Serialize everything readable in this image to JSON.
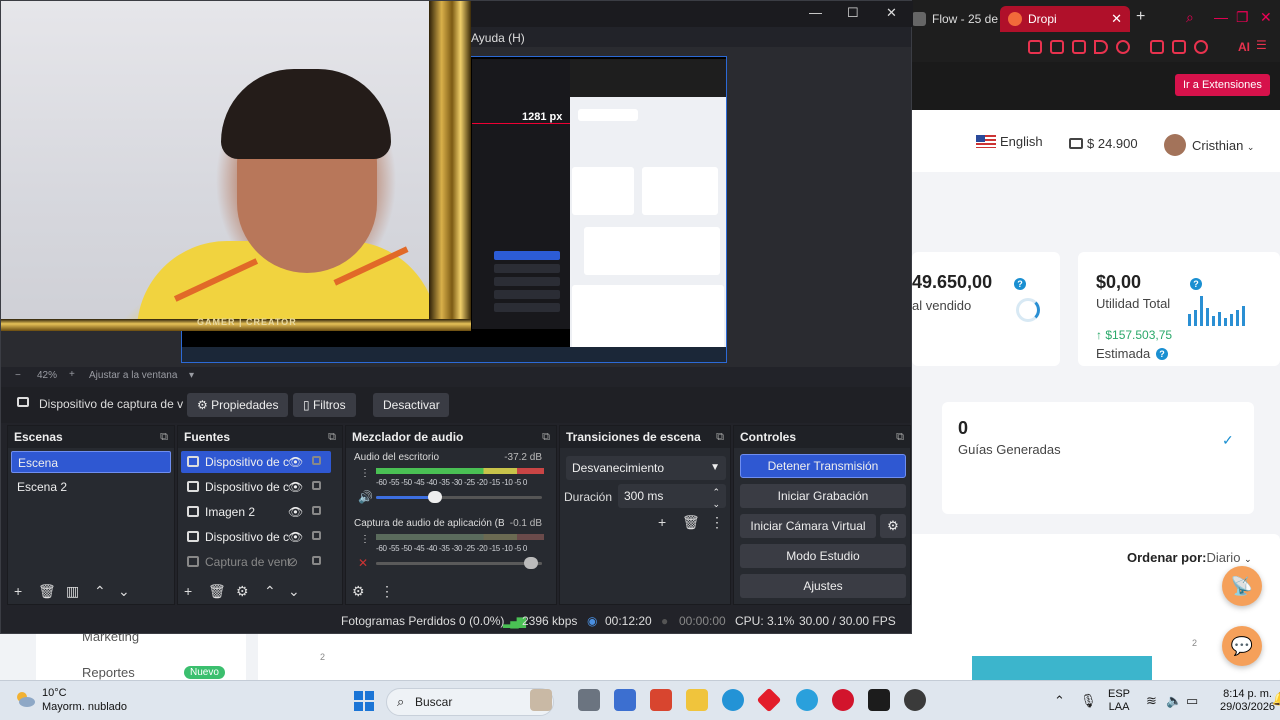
{
  "browser": {
    "tabs": [
      {
        "label": "Flow - 25 de"
      },
      {
        "label": "Dropi"
      }
    ],
    "new_tab": "+",
    "ai_label": "AI",
    "extensions_button": "Ir a Extensiones",
    "language": "English",
    "wallet": "$ 24.900",
    "user_name": "Cristhian",
    "sold_value": "49.650,00",
    "sold_label": "al vendido",
    "utility_value": "$0,00",
    "utility_label": "Utilidad Total",
    "estimated_value": "$157.503,75",
    "estimated_label": "Estimada",
    "guides_value": "0",
    "guides_label": "Guías Generadas",
    "order_label": "Ordenar por:",
    "order_value": "Diario",
    "sidebar_marketing": "Marketing",
    "sidebar_reports": "Reportes",
    "new_badge": "Nuevo",
    "chart_tick": "2"
  },
  "obs": {
    "menu_help": "Ayuda (H)",
    "mini_px_label": "1281 px",
    "frame_label": "GAMER | CREATOR",
    "zoom": "42%",
    "fit_label": "Ajustar a la ventana",
    "source_name": "Dispositivo de captura de v",
    "properties": "Propiedades",
    "filters": "Filtros",
    "deactivate": "Desactivar",
    "docks": {
      "scenes": "Escenas",
      "sources": "Fuentes",
      "mixer": "Mezclador de audio",
      "transitions": "Transiciones de escena",
      "controls": "Controles"
    },
    "scenes": [
      "Escena",
      "Escena 2"
    ],
    "sources": [
      "Dispositivo de c",
      "Dispositivo de c",
      "Imagen 2",
      "Dispositivo de c",
      "Captura de vent"
    ],
    "mixer": [
      {
        "name": "Audio del escritorio",
        "db": "-37.2 dB",
        "level": 0.36,
        "volume": 0.35
      },
      {
        "name": "Captura de audio de aplicación (BE",
        "db": "-0.1 dB",
        "level": 0.0,
        "volume": 1.0
      }
    ],
    "meter_scale": "-60 -55 -50 -45 -40 -35 -30 -25 -20 -15 -10 -5  0",
    "transition": "Desvanecimiento",
    "duration_label": "Duración",
    "duration_value": "300 ms",
    "controls": {
      "stream": "Detener Transmisión",
      "record": "Iniciar Grabación",
      "virtual_cam": "Iniciar Cámara Virtual",
      "studio": "Modo Estudio",
      "settings": "Ajustes"
    },
    "status": {
      "dropped": "Fotogramas Perdidos 0 (0.0%)",
      "bitrate": "2396 kbps",
      "stream_time": "00:12:20",
      "record_time": "00:00:00",
      "cpu": "CPU: 3.1%",
      "fps": "30.00 / 30.00 FPS"
    }
  },
  "taskbar": {
    "temperature": "10°C",
    "weather": "Mayorm. nublado",
    "search": "Buscar",
    "lang_1": "ESP",
    "lang_2": "LAA",
    "time": "8:14 p. m.",
    "date": "29/03/2026"
  },
  "colors": {
    "accent_blue": "#2f58d2",
    "dropi_red": "#d6124b",
    "fab_orange": "#f5a05a"
  }
}
